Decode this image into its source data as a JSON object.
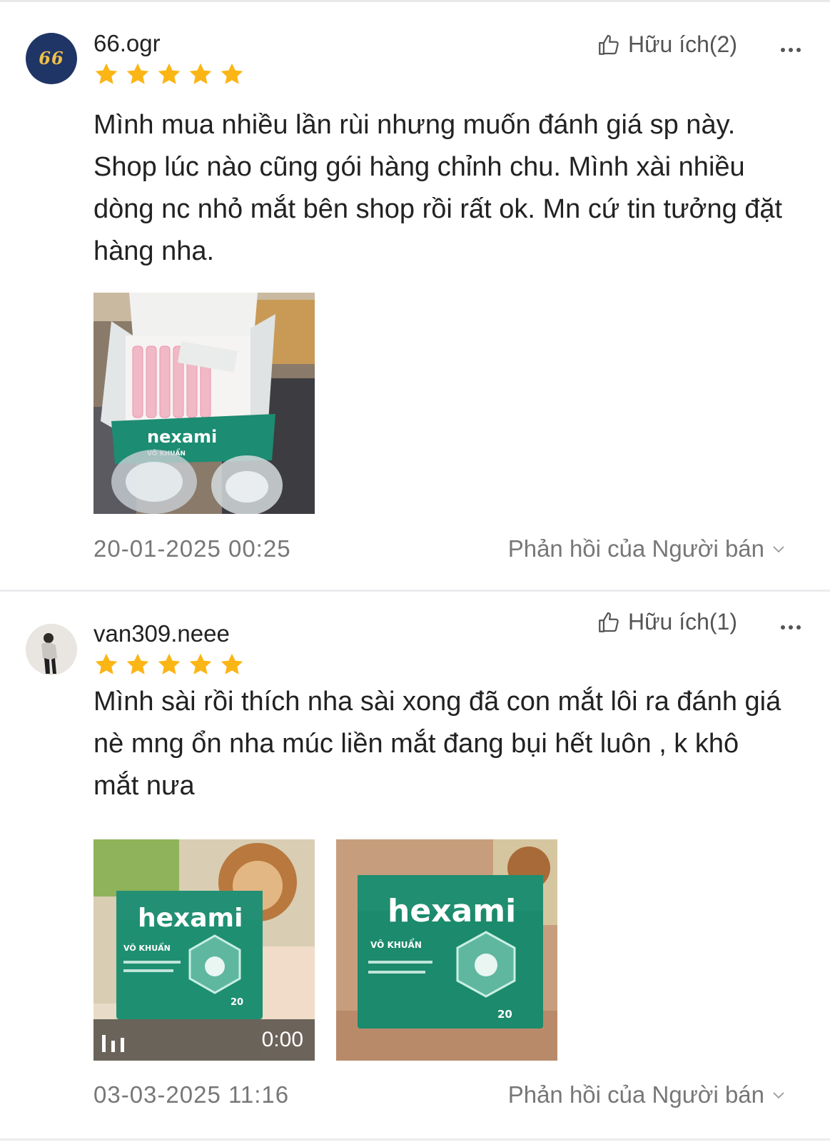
{
  "colors": {
    "star": "#fbb515",
    "accent_avatar": "#1f3565",
    "muted_text": "#777777",
    "brand_box": "#1c8c72"
  },
  "reviews": [
    {
      "avatar_text": "66",
      "username": "66.ogr",
      "rating": 5,
      "helpful_label": "Hữu ích(2)",
      "content": "Mình mua nhiều lần rùi nhưng muốn đánh giá sp này. Shop lúc nào cũng gói hàng chỉnh chu. Mình xài nhiều dòng nc nhỏ mắt bên shop rồi rất ok. Mn cứ tin tưởng đặt hàng nha.",
      "media": [
        {
          "type": "photo",
          "brand_text": "nexami",
          "sub_text": "VÔ KHUẨN"
        }
      ],
      "date": "20-01-2025 00:25",
      "reply_label": "Phản hồi của Người bán"
    },
    {
      "username": "van309.neee",
      "rating": 5,
      "helpful_label": "Hữu ích(1)",
      "content": "Mình sài rồi thích nha sài xong đã con mắt lôi ra đánh giá nè mng ổn nha múc liền mắt đang bụi hết luôn , k khô mắt nưa",
      "media": [
        {
          "type": "video",
          "brand_text": "hexami",
          "sub_text": "VÔ KHUẨN",
          "count_text": "20",
          "duration": "0:00"
        },
        {
          "type": "photo",
          "brand_text": "hexami",
          "sub_text": "VÔ KHUẨN",
          "count_text": "20"
        }
      ],
      "date": "03-03-2025 11:16",
      "reply_label": "Phản hồi của Người bán"
    }
  ]
}
